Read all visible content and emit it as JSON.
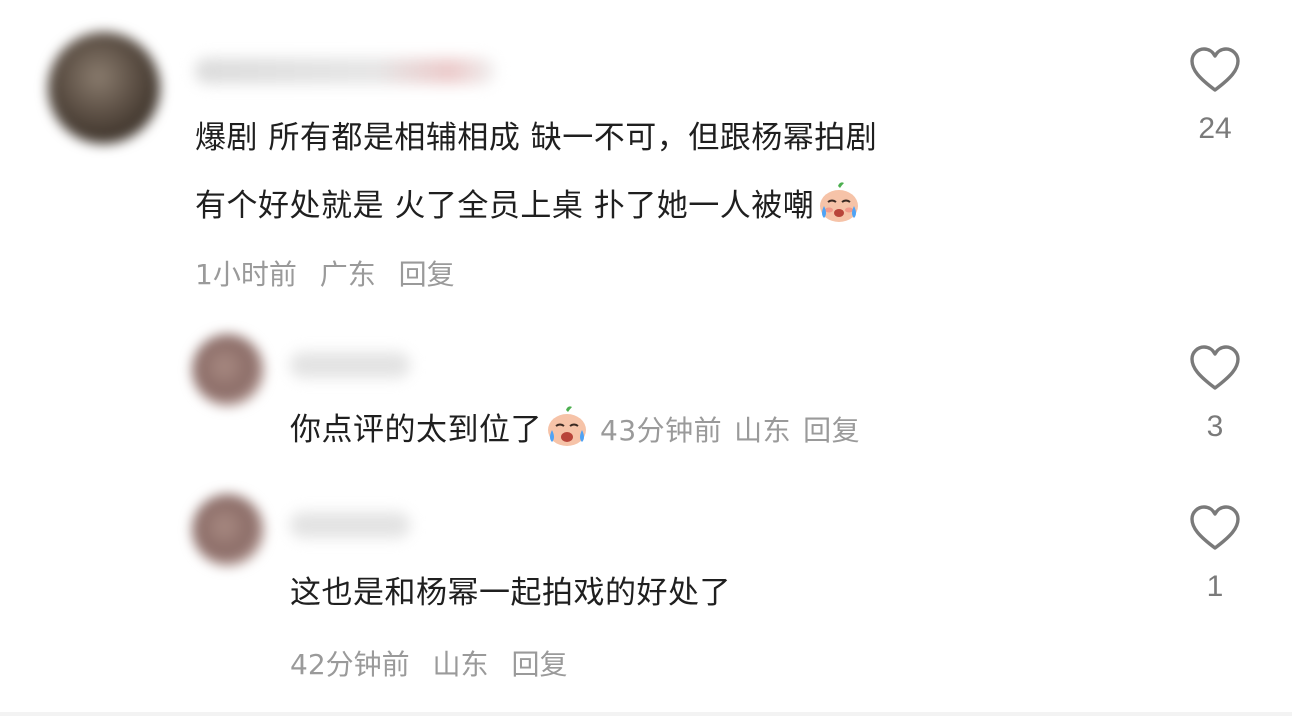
{
  "comments": [
    {
      "text_line1": "爆剧 所有都是相辅相成 缺一不可，但跟杨幂拍剧",
      "text_line2": "有个好处就是 火了全员上桌 扑了她一人被嘲",
      "emoji_name": "crying-face-emoji",
      "time": "1小时前",
      "location": "广东",
      "reply_label": "回复",
      "likes": "24"
    }
  ],
  "replies": [
    {
      "text": "你点评的太到位了",
      "emoji_name": "crying-face-emoji",
      "time": "43分钟前",
      "location": "山东",
      "reply_label": "回复",
      "likes": "3"
    },
    {
      "text": "这也是和杨幂一起拍戏的好处了",
      "time": "42分钟前",
      "location": "山东",
      "reply_label": "回复",
      "likes": "1"
    }
  ],
  "icons": {
    "like": "heart-outline-icon"
  },
  "colors": {
    "text": "#1f1f1f",
    "meta": "#9a9a9a",
    "like_count": "#7a7a7a",
    "heart_stroke": "#7a7a7a"
  }
}
